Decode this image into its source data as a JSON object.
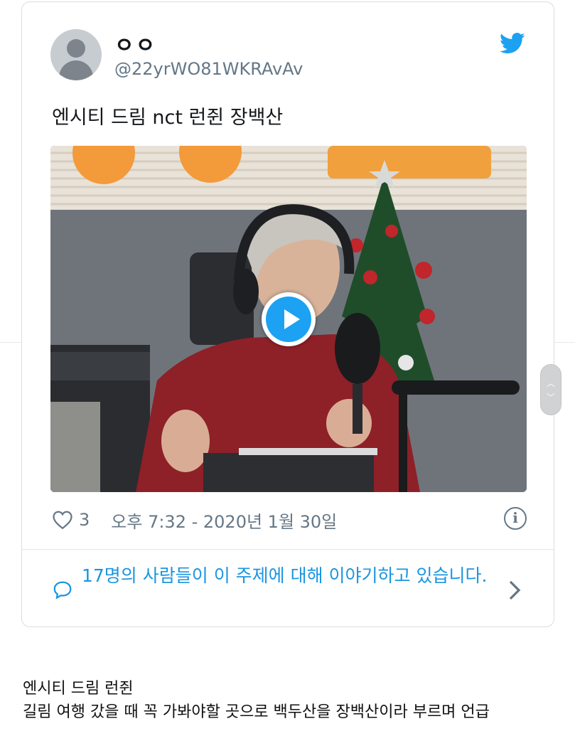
{
  "tweet": {
    "display_name": "ㅇㅇ",
    "handle": "@22yrWO81WKRAvAv",
    "text": "엔시티 드림 nct 런쥔 장백산",
    "like_count": "3",
    "timestamp": "오후 7:32 - 2020년 1월 30일",
    "conversation_text": "17명의 사람들이 이 주제에 대해 이야기하고 있습니다.",
    "brand_color": "#1da1f2",
    "icons": [
      "twitter-bird-icon",
      "play-icon",
      "heart-icon",
      "info-icon",
      "chat-bubble-icon",
      "chevron-right-icon"
    ]
  },
  "caption": {
    "line1": "엔시티 드림 런쥔",
    "line2": "길림 여행 갔을 때 꼭 가봐야할 곳으로 백두산을 장백산이라 부르며 언급"
  }
}
